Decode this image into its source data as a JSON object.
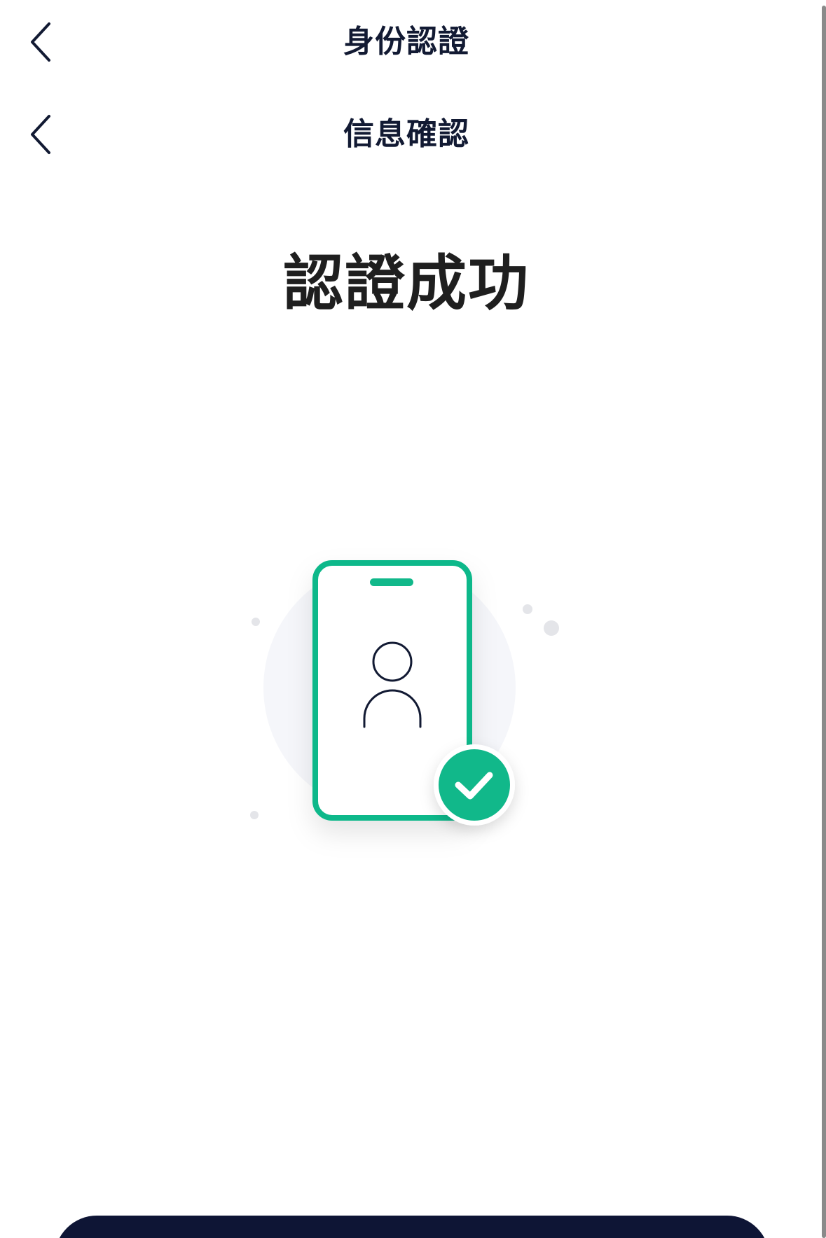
{
  "nav": {
    "top_title": "身份認證",
    "sub_title": "信息確認"
  },
  "icons": {
    "back": "chevron-left-icon",
    "illustration": "phone-user-verified-icon",
    "check": "check-icon"
  },
  "result": {
    "title": "認證成功"
  },
  "colors": {
    "accent_green": "#11b88a",
    "nav_text": "#121a33",
    "title_text": "#1f1f1f",
    "button_bg": "#0e1535"
  }
}
